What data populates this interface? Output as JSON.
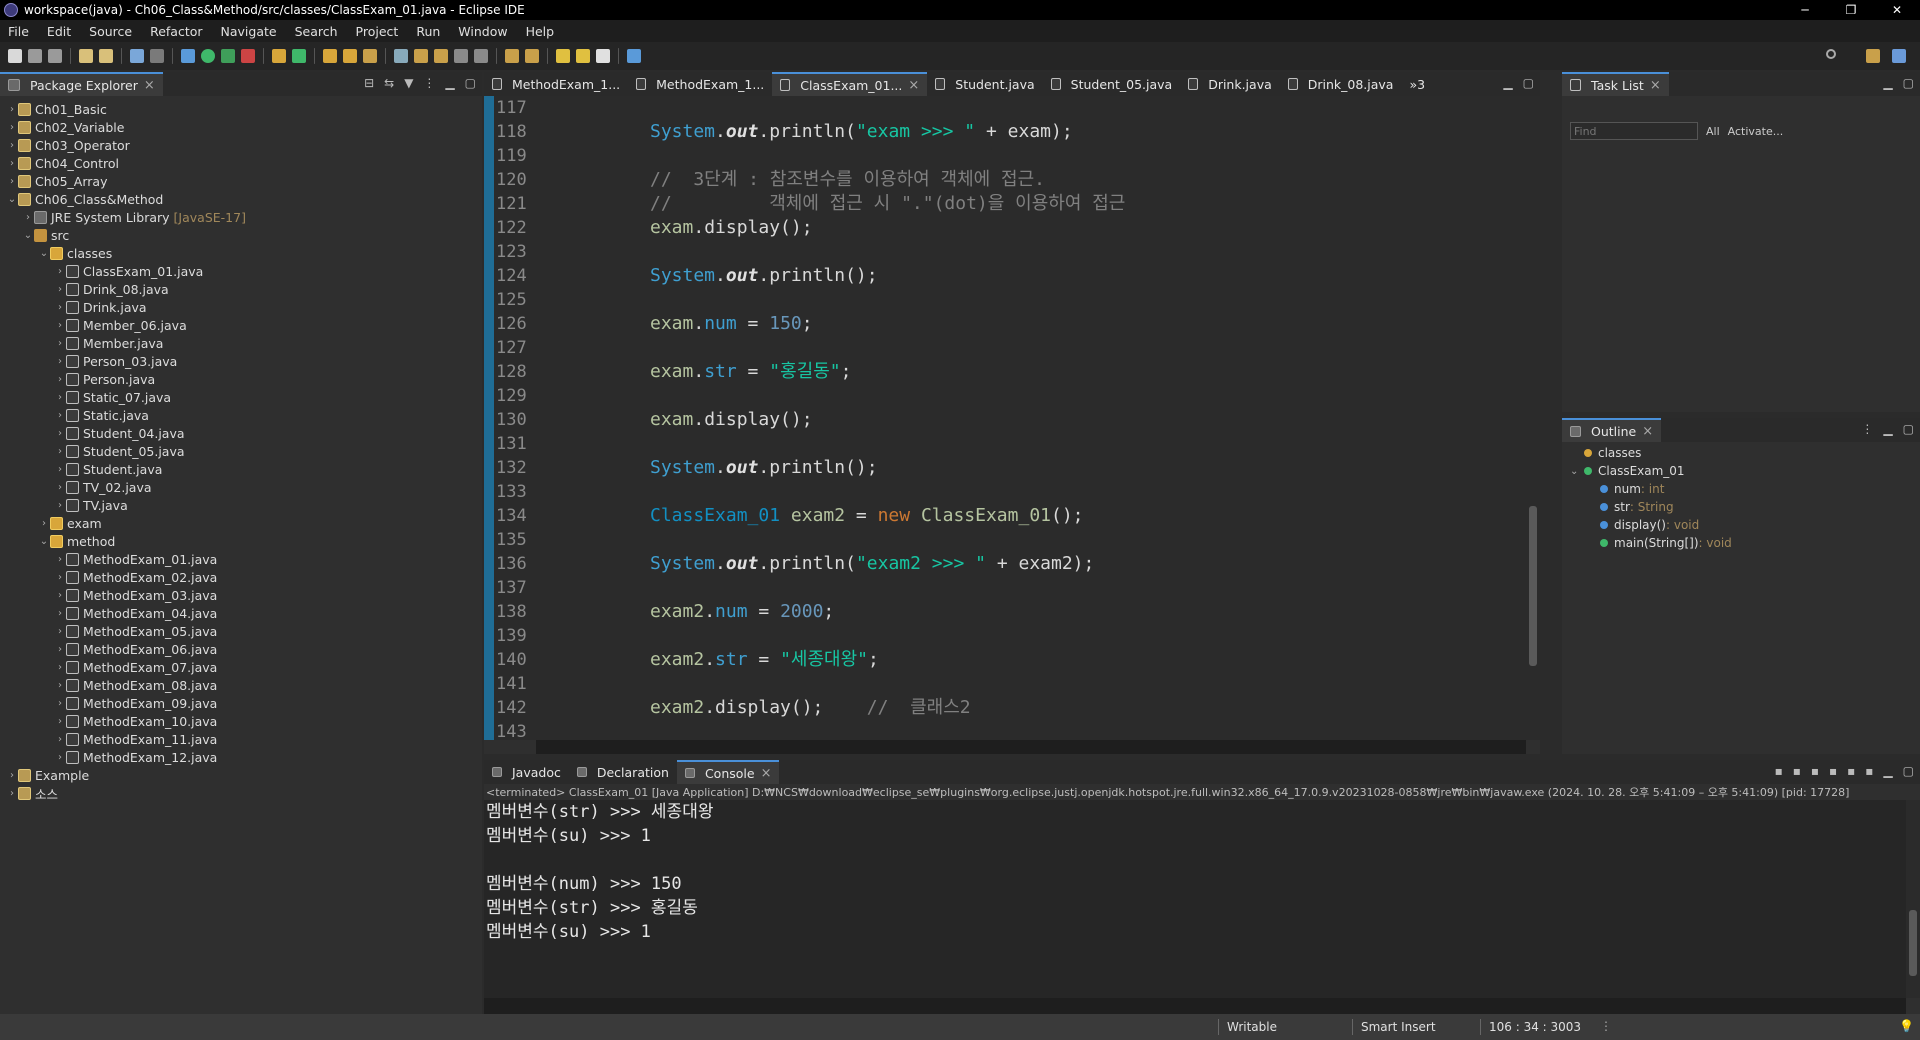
{
  "window": {
    "title": "workspace(java) - Ch06_Class&Method/src/classes/ClassExam_01.java - Eclipse IDE",
    "controls": [
      "─",
      "❐",
      "✕"
    ]
  },
  "menu": [
    "File",
    "Edit",
    "Source",
    "Refactor",
    "Navigate",
    "Search",
    "Project",
    "Run",
    "Window",
    "Help"
  ],
  "package_explorer": {
    "tab": "Package Explorer",
    "rows": [
      {
        "indent": 0,
        "twisty": "›",
        "icon": "proj",
        "label": "Ch01_Basic"
      },
      {
        "indent": 0,
        "twisty": "›",
        "icon": "proj",
        "label": "Ch02_Variable"
      },
      {
        "indent": 0,
        "twisty": "›",
        "icon": "proj",
        "label": "Ch03_Operator"
      },
      {
        "indent": 0,
        "twisty": "›",
        "icon": "proj",
        "label": "Ch04_Control"
      },
      {
        "indent": 0,
        "twisty": "›",
        "icon": "proj",
        "label": "Ch05_Array"
      },
      {
        "indent": 0,
        "twisty": "⌄",
        "icon": "proj",
        "label": "Ch06_Class&Method"
      },
      {
        "indent": 1,
        "twisty": "›",
        "icon": "lib",
        "label": "JRE System Library",
        "tag": "[JavaSE-17]"
      },
      {
        "indent": 1,
        "twisty": "⌄",
        "icon": "src",
        "label": "src"
      },
      {
        "indent": 2,
        "twisty": "⌄",
        "icon": "pkg",
        "label": "classes"
      },
      {
        "indent": 3,
        "twisty": "›",
        "icon": "java",
        "label": "ClassExam_01.java"
      },
      {
        "indent": 3,
        "twisty": "›",
        "icon": "java",
        "label": "Drink_08.java"
      },
      {
        "indent": 3,
        "twisty": "›",
        "icon": "java",
        "label": "Drink.java"
      },
      {
        "indent": 3,
        "twisty": "›",
        "icon": "java",
        "label": "Member_06.java"
      },
      {
        "indent": 3,
        "twisty": "›",
        "icon": "java",
        "label": "Member.java"
      },
      {
        "indent": 3,
        "twisty": "›",
        "icon": "java",
        "label": "Person_03.java"
      },
      {
        "indent": 3,
        "twisty": "›",
        "icon": "java",
        "label": "Person.java"
      },
      {
        "indent": 3,
        "twisty": "›",
        "icon": "java",
        "label": "Static_07.java"
      },
      {
        "indent": 3,
        "twisty": "›",
        "icon": "java",
        "label": "Static.java"
      },
      {
        "indent": 3,
        "twisty": "›",
        "icon": "java",
        "label": "Student_04.java"
      },
      {
        "indent": 3,
        "twisty": "›",
        "icon": "java",
        "label": "Student_05.java"
      },
      {
        "indent": 3,
        "twisty": "›",
        "icon": "java",
        "label": "Student.java"
      },
      {
        "indent": 3,
        "twisty": "›",
        "icon": "java",
        "label": "TV_02.java"
      },
      {
        "indent": 3,
        "twisty": "›",
        "icon": "java",
        "label": "TV.java"
      },
      {
        "indent": 2,
        "twisty": "›",
        "icon": "pkg",
        "label": "exam"
      },
      {
        "indent": 2,
        "twisty": "⌄",
        "icon": "pkg",
        "label": "method"
      },
      {
        "indent": 3,
        "twisty": "›",
        "icon": "java",
        "label": "MethodExam_01.java"
      },
      {
        "indent": 3,
        "twisty": "›",
        "icon": "java",
        "label": "MethodExam_02.java"
      },
      {
        "indent": 3,
        "twisty": "›",
        "icon": "java",
        "label": "MethodExam_03.java"
      },
      {
        "indent": 3,
        "twisty": "›",
        "icon": "java",
        "label": "MethodExam_04.java"
      },
      {
        "indent": 3,
        "twisty": "›",
        "icon": "java",
        "label": "MethodExam_05.java"
      },
      {
        "indent": 3,
        "twisty": "›",
        "icon": "java",
        "label": "MethodExam_06.java"
      },
      {
        "indent": 3,
        "twisty": "›",
        "icon": "java",
        "label": "MethodExam_07.java"
      },
      {
        "indent": 3,
        "twisty": "›",
        "icon": "java",
        "label": "MethodExam_08.java"
      },
      {
        "indent": 3,
        "twisty": "›",
        "icon": "java",
        "label": "MethodExam_09.java"
      },
      {
        "indent": 3,
        "twisty": "›",
        "icon": "java",
        "label": "MethodExam_10.java"
      },
      {
        "indent": 3,
        "twisty": "›",
        "icon": "java",
        "label": "MethodExam_11.java"
      },
      {
        "indent": 3,
        "twisty": "›",
        "icon": "java",
        "label": "MethodExam_12.java"
      },
      {
        "indent": 0,
        "twisty": "›",
        "icon": "proj",
        "label": "Example"
      },
      {
        "indent": 0,
        "twisty": "›",
        "icon": "proj",
        "label": "소스"
      }
    ]
  },
  "editor": {
    "tabs": [
      {
        "label": "MethodExam_1...",
        "active": false
      },
      {
        "label": "MethodExam_1...",
        "active": false
      },
      {
        "label": "ClassExam_01...",
        "active": true
      },
      {
        "label": "Student.java",
        "active": false
      },
      {
        "label": "Student_05.java",
        "active": false
      },
      {
        "label": "Drink.java",
        "active": false
      },
      {
        "label": "Drink_08.java",
        "active": false
      }
    ],
    "overflow": "»3",
    "lines": [
      {
        "no": "117",
        "tokens": []
      },
      {
        "no": "118",
        "tokens": [
          [
            "sys",
            "System"
          ],
          [
            "p",
            "."
          ],
          [
            "out",
            "out"
          ],
          [
            "p",
            ".println("
          ],
          [
            "str",
            "\"exam >>> \""
          ],
          [
            "p",
            " + exam);"
          ]
        ]
      },
      {
        "no": "119",
        "tokens": []
      },
      {
        "no": "120",
        "tokens": [
          [
            "cmt",
            "//  3단계 : 참조변수를 이용하여 객체에 접근."
          ]
        ]
      },
      {
        "no": "121",
        "tokens": [
          [
            "cmt",
            "//         객체에 접근 시 \".\"(dot)을 이용하여 접근"
          ]
        ]
      },
      {
        "no": "122",
        "tokens": [
          [
            "var",
            "exam"
          ],
          [
            "p",
            ".display();"
          ]
        ]
      },
      {
        "no": "123",
        "tokens": []
      },
      {
        "no": "124",
        "tokens": [
          [
            "sys",
            "System"
          ],
          [
            "p",
            "."
          ],
          [
            "out",
            "out"
          ],
          [
            "p",
            ".println();"
          ]
        ]
      },
      {
        "no": "125",
        "tokens": []
      },
      {
        "no": "126",
        "tokens": [
          [
            "var",
            "exam"
          ],
          [
            "p",
            "."
          ],
          [
            "sys",
            "num"
          ],
          [
            "p",
            " = "
          ],
          [
            "num",
            "150"
          ],
          [
            "p",
            ";"
          ]
        ]
      },
      {
        "no": "127",
        "tokens": []
      },
      {
        "no": "128",
        "tokens": [
          [
            "var",
            "exam"
          ],
          [
            "p",
            "."
          ],
          [
            "sys",
            "str"
          ],
          [
            "p",
            " = "
          ],
          [
            "str",
            "\"홍길동\""
          ],
          [
            "p",
            ";"
          ]
        ]
      },
      {
        "no": "129",
        "tokens": []
      },
      {
        "no": "130",
        "tokens": [
          [
            "var",
            "exam"
          ],
          [
            "p",
            ".display();"
          ]
        ]
      },
      {
        "no": "131",
        "tokens": []
      },
      {
        "no": "132",
        "tokens": [
          [
            "sys",
            "System"
          ],
          [
            "p",
            "."
          ],
          [
            "out",
            "out"
          ],
          [
            "p",
            ".println();"
          ]
        ]
      },
      {
        "no": "133",
        "tokens": []
      },
      {
        "no": "134",
        "tokens": [
          [
            "cls",
            "ClassExam_01"
          ],
          [
            "p",
            " "
          ],
          [
            "var",
            "exam2"
          ],
          [
            "p",
            " = "
          ],
          [
            "kw",
            "new"
          ],
          [
            "p",
            " "
          ],
          [
            "var",
            "ClassExam_01"
          ],
          [
            "p",
            "();"
          ]
        ]
      },
      {
        "no": "135",
        "tokens": []
      },
      {
        "no": "136",
        "tokens": [
          [
            "sys",
            "System"
          ],
          [
            "p",
            "."
          ],
          [
            "out",
            "out"
          ],
          [
            "p",
            ".println("
          ],
          [
            "str",
            "\"exam2 >>> \""
          ],
          [
            "p",
            " + exam2);"
          ]
        ]
      },
      {
        "no": "137",
        "tokens": []
      },
      {
        "no": "138",
        "tokens": [
          [
            "var",
            "exam2"
          ],
          [
            "p",
            "."
          ],
          [
            "sys",
            "num"
          ],
          [
            "p",
            " = "
          ],
          [
            "num",
            "2000"
          ],
          [
            "p",
            ";"
          ]
        ]
      },
      {
        "no": "139",
        "tokens": []
      },
      {
        "no": "140",
        "tokens": [
          [
            "var",
            "exam2"
          ],
          [
            "p",
            "."
          ],
          [
            "sys",
            "str"
          ],
          [
            "p",
            " = "
          ],
          [
            "str",
            "\"세종대왕\""
          ],
          [
            "p",
            ";"
          ]
        ]
      },
      {
        "no": "141",
        "tokens": []
      },
      {
        "no": "142",
        "tokens": [
          [
            "var",
            "exam2"
          ],
          [
            "p",
            ".display();    "
          ],
          [
            "cmt",
            "//  클래스2"
          ]
        ]
      },
      {
        "no": "143",
        "tokens": []
      }
    ]
  },
  "task_list": {
    "tab": "Task List",
    "find_placeholder": "Find",
    "all_label": "All",
    "activate_label": "Activate..."
  },
  "outline": {
    "tab": "Outline",
    "rows": [
      {
        "indent": 0,
        "dot": "#d8a63a",
        "label": "classes",
        "type": ""
      },
      {
        "indent": 0,
        "dot": "#3fb86a",
        "label": "ClassExam_01",
        "type": "",
        "twisty": "⌄"
      },
      {
        "indent": 1,
        "dot": "#4a90d9",
        "label": "num",
        "type": " : int"
      },
      {
        "indent": 1,
        "dot": "#4a90d9",
        "label": "str",
        "type": " : String"
      },
      {
        "indent": 1,
        "dot": "#4a90d9",
        "label": "display()",
        "type": " : void"
      },
      {
        "indent": 1,
        "dot": "#3fb86a",
        "label": "main(String[])",
        "type": " : void"
      }
    ]
  },
  "console": {
    "tabs": [
      {
        "label": "Javadoc",
        "active": false
      },
      {
        "label": "Declaration",
        "active": false
      },
      {
        "label": "Console",
        "active": true
      }
    ],
    "header": "<terminated> ClassExam_01 [Java Application] D:₩NCS₩download₩eclipse_se₩plugins₩org.eclipse.justj.openjdk.hotspot.jre.full.win32.x86_64_17.0.9.v20231028-0858₩jre₩bin₩javaw.exe  (2024. 10. 28. 오후 5:41:09 – 오후 5:41:09) [pid: 17728]",
    "lines": [
      "멤버변수(str) >>> 세종대왕",
      "멤버변수(su) >>> 1",
      "",
      "멤버변수(num) >>> 150",
      "멤버변수(str) >>> 홍길동",
      "멤버변수(su) >>> 1"
    ]
  },
  "status": {
    "mode": "Writable",
    "insert": "Smart Insert",
    "position": "106 : 34 : 3003"
  },
  "colors": {
    "accent": "#4a90d9",
    "gutter": "#1f6d96"
  }
}
